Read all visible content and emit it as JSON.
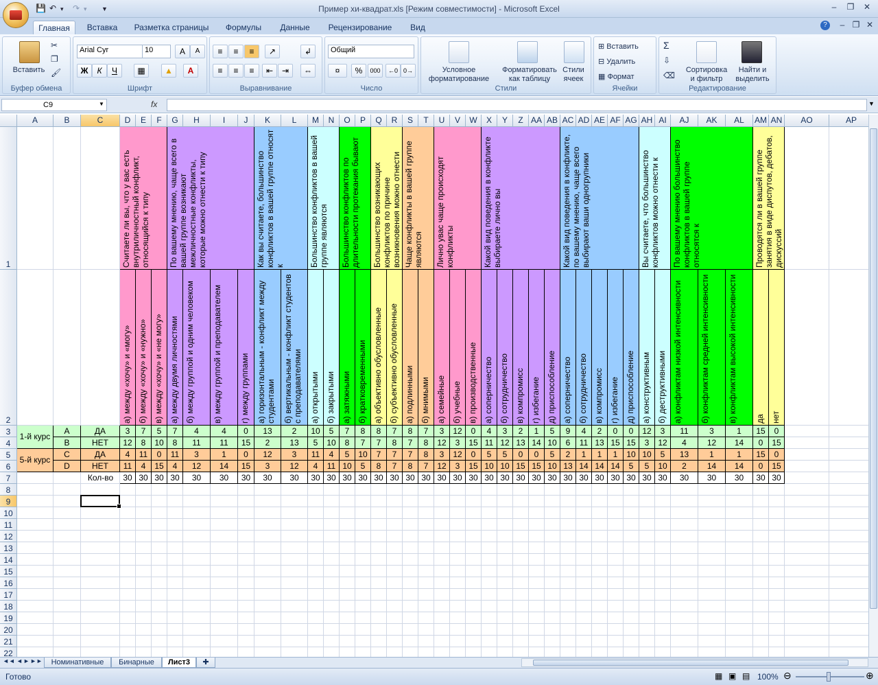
{
  "window": {
    "title": "Пример хи-квадрат.xls  [Режим совместимости] - Microsoft Excel"
  },
  "tabs": [
    "Главная",
    "Вставка",
    "Разметка страницы",
    "Формулы",
    "Данные",
    "Рецензирование",
    "Вид"
  ],
  "ribbon": {
    "clipboard": {
      "label": "Буфер обмена",
      "paste": "Вставить"
    },
    "font": {
      "label": "Шрифт",
      "name": "Arial Cyr",
      "size": "10",
      "bold": "Ж",
      "italic": "К",
      "underline": "Ч"
    },
    "align": {
      "label": "Выравнивание"
    },
    "number": {
      "label": "Число",
      "format": "Общий",
      "percent": "%",
      "thousands": "000"
    },
    "styles": {
      "label": "Стили",
      "cond": "Условное\nформатирование",
      "table": "Форматировать\nкак таблицу",
      "cell": "Стили\nячеек"
    },
    "cells": {
      "label": "Ячейки",
      "insert": "Вставить",
      "delete": "Удалить",
      "format": "Формат"
    },
    "edit": {
      "label": "Редактирование",
      "sort": "Сортировка\nи фильтр",
      "find": "Найти и\nвыделить"
    }
  },
  "formula_bar": {
    "name_box": "C9",
    "fx": "fx",
    "formula": ""
  },
  "columns": [
    "A",
    "B",
    "C",
    "D",
    "E",
    "F",
    "G",
    "H",
    "I",
    "J",
    "K",
    "L",
    "M",
    "N",
    "O",
    "P",
    "Q",
    "R",
    "S",
    "T",
    "U",
    "V",
    "W",
    "X",
    "Y",
    "Z",
    "AA",
    "AB",
    "AC",
    "AD",
    "AE",
    "AF",
    "AG",
    "AH",
    "AI",
    "AJ",
    "AK",
    "AL",
    "AM",
    "AN",
    "AO",
    "AP"
  ],
  "row_numbers": [
    "1",
    "2",
    "3",
    "4",
    "5",
    "6",
    "7",
    "8",
    "9",
    "10",
    "11",
    "12",
    "13",
    "14",
    "15",
    "16",
    "17",
    "18",
    "19",
    "20",
    "21",
    "22"
  ],
  "questions": [
    {
      "text": "Считаете ли вы, что у вас есть внутриличностный конфликт, относящийся к типу",
      "color": "#ff99cc"
    },
    {
      "text": "По вашему мнению, чаще всего в вашей группе возникают межличностные конфликты, которые можно отнести к типу",
      "color": "#cc99ff"
    },
    {
      "text": "Как вы считаете, большинство конфликтов в вашей группе относят к",
      "color": "#99ccff"
    },
    {
      "text": "Большинство конфликтов в вашей группе являются",
      "color": "#ccffff"
    },
    {
      "text": "Большинство конфликтов по длительности протекания бывают",
      "color": "#00ff00"
    },
    {
      "text": "Большинство возникающих конфликтов по причине возникновения можно отнести",
      "color": "#ffff99"
    },
    {
      "text": "Чаще конфликты в вашей группе являются",
      "color": "#ffcc99"
    },
    {
      "text": "Лично увас чаще происходят конфликты",
      "color": "#ff99cc"
    },
    {
      "text": "Какой вид поведения в конфликте выбираете лично вы",
      "color": "#cc99ff"
    },
    {
      "text": "Какой вид поведения в конфликте, по вашему мнению, чаще всего выбирают ваши одногрупники",
      "color": "#99ccff"
    },
    {
      "text": "Вы считаете, что большинство конфликтов можно отнести к",
      "color": "#ccffff"
    },
    {
      "text": "По вашему мнению большинство конфликтов в вашей группе относятся к",
      "color": "#00ff00"
    },
    {
      "text": "Проводятся ли в вашей группе занятия в виде диспутов, дебатов, дискуссий",
      "color": "#ffff99"
    }
  ],
  "answers": [
    "а) между «хочу» и «могу»",
    "б) между «хочу» и «нужно»",
    "в) между «хочу» и «не могу»",
    "а) между двумя личностями",
    "б) между группой и одним человеком",
    "в) между группой и преподавателем",
    "г) между группами",
    "а) горизонтальным - конфликт между студентами",
    "б) вертикальным - конфликт студентов с преподавателями",
    "а) открытыми",
    "б) закрытыми",
    "а) затяжными",
    "б) кратковременными",
    "а) объективно обусловленные",
    "б) субъективно обусловленные",
    "а) подлинными",
    "б) мнимыми",
    "а) семейные",
    "б) учебные",
    "в) производственные",
    "а) соперничество",
    "б) сотрудничество",
    "в) компромисс",
    "г) избегание",
    "д) приспособление",
    "а) соперничество",
    "б) сотрудничество",
    "в) компромисс",
    "г) избегание",
    "д) приспособление",
    "а) конструктивным",
    "б) деструктивными",
    "а) конфликтам низкой интенсивности",
    "б) конфликтам средней интенсивности",
    "в) конфликтам высокой интенсивности",
    "да",
    "нет"
  ],
  "rows": [
    {
      "course": "1-й курс",
      "code": "A",
      "label": "ДА",
      "values": [
        3,
        7,
        5,
        7,
        4,
        4,
        0,
        13,
        2,
        10,
        5,
        7,
        8,
        8,
        7,
        8,
        7,
        3,
        12,
        0,
        4,
        3,
        2,
        1,
        5,
        9,
        4,
        2,
        0,
        0,
        12,
        3,
        11,
        3,
        1,
        15,
        0
      ]
    },
    {
      "course": "",
      "code": "B",
      "label": "НЕТ",
      "values": [
        12,
        8,
        10,
        8,
        11,
        11,
        15,
        2,
        13,
        5,
        10,
        8,
        7,
        7,
        8,
        7,
        8,
        12,
        3,
        15,
        11,
        12,
        13,
        14,
        10,
        6,
        11,
        13,
        15,
        15,
        3,
        12,
        4,
        12,
        14,
        0,
        15
      ]
    },
    {
      "course": "5-й курс",
      "code": "C",
      "label": "ДА",
      "values": [
        4,
        11,
        0,
        11,
        3,
        1,
        0,
        12,
        3,
        11,
        4,
        5,
        10,
        7,
        7,
        7,
        8,
        3,
        12,
        0,
        5,
        5,
        0,
        0,
        5,
        2,
        1,
        1,
        1,
        10,
        10,
        5,
        13,
        1,
        1,
        15,
        0
      ]
    },
    {
      "course": "",
      "code": "D",
      "label": "НЕТ",
      "values": [
        11,
        4,
        15,
        4,
        12,
        14,
        15,
        3,
        12,
        4,
        11,
        10,
        5,
        8,
        7,
        8,
        7,
        12,
        3,
        15,
        10,
        10,
        15,
        15,
        10,
        13,
        14,
        14,
        14,
        5,
        5,
        10,
        2,
        14,
        14,
        0,
        15
      ]
    },
    {
      "course": "",
      "code": "",
      "label": "Кол-во",
      "values": [
        30,
        30,
        30,
        30,
        30,
        30,
        30,
        30,
        30,
        30,
        30,
        30,
        30,
        30,
        30,
        30,
        30,
        30,
        30,
        30,
        30,
        30,
        30,
        30,
        30,
        30,
        30,
        30,
        30,
        30,
        30,
        30,
        30,
        30,
        30,
        30,
        30
      ]
    }
  ],
  "sheets": [
    "Номинативные",
    "Бинарные",
    "Лист3"
  ],
  "status": {
    "ready": "Готово",
    "zoom": "100%"
  }
}
